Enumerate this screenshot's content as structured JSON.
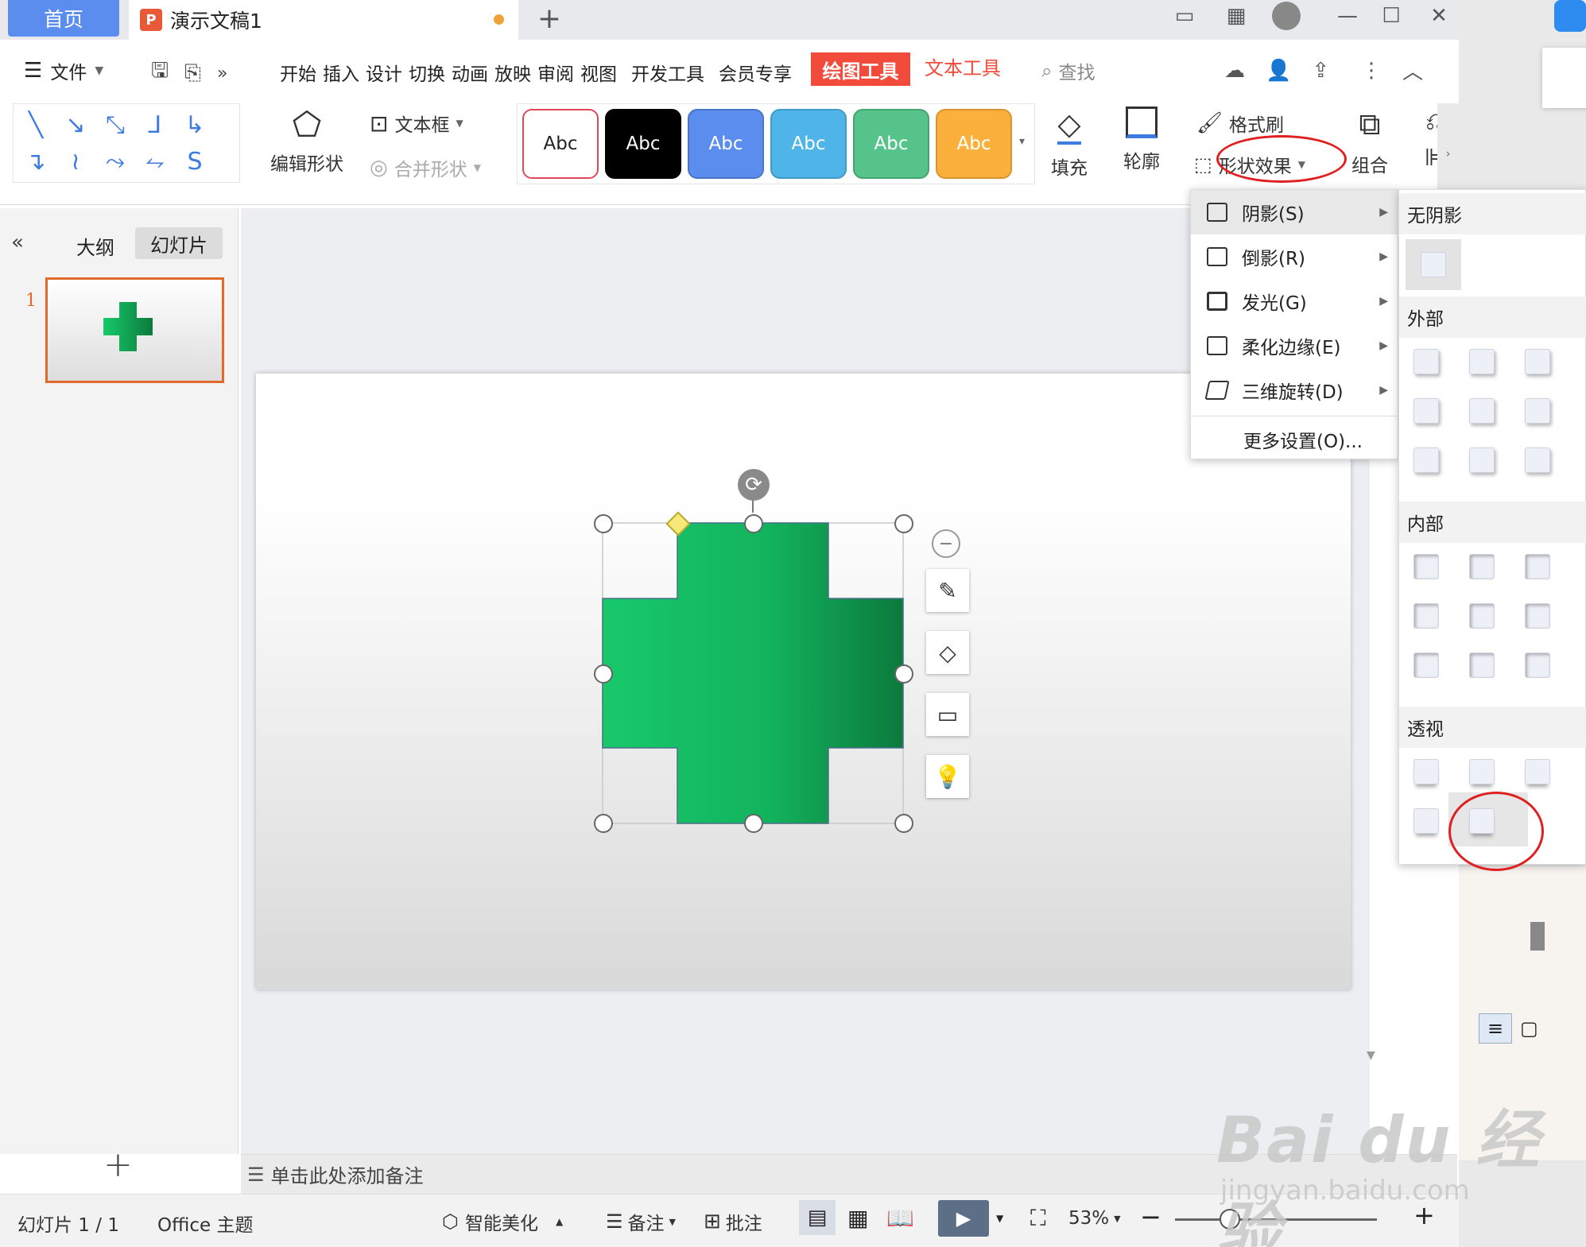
{
  "tabs": {
    "home": "首页",
    "document": "演示文稿1",
    "new_tab": "+"
  },
  "menu": {
    "file": "文件",
    "items": [
      "开始",
      "插入",
      "设计",
      "切换",
      "动画",
      "放映",
      "审阅",
      "视图",
      "开发工具",
      "会员专享"
    ],
    "drawing_tools": "绘图工具",
    "text_tools": "文本工具",
    "search": "查找"
  },
  "ribbon": {
    "edit_shape": "编辑形状",
    "text_box": "文本框",
    "merge_shapes": "合并形状",
    "style_samples": [
      {
        "label": "Abc",
        "bg": "#ffffff",
        "fg": "#222222",
        "border": "#e0485a"
      },
      {
        "label": "Abc",
        "bg": "#000000",
        "fg": "#ffffff",
        "border": "#000000"
      },
      {
        "label": "Abc",
        "bg": "#5b8def",
        "fg": "#ffffff",
        "border": "#4a74c9"
      },
      {
        "label": "Abc",
        "bg": "#4fb5e8",
        "fg": "#ffffff",
        "border": "#3f9ac8"
      },
      {
        "label": "Abc",
        "bg": "#56c48a",
        "fg": "#ffffff",
        "border": "#46a372"
      },
      {
        "label": "Abc",
        "bg": "#fbb03b",
        "fg": "#ffffff",
        "border": "#d9942d"
      }
    ],
    "fill": "填充",
    "outline": "轮廓",
    "format_painter": "格式刷",
    "shape_effects": "形状效果",
    "group": "组合"
  },
  "left_panel": {
    "outline_tab": "大纲",
    "slides_tab": "幻灯片",
    "slide_number": "1",
    "add": "+"
  },
  "effects_menu": {
    "items": [
      {
        "label": "阴影(S)"
      },
      {
        "label": "倒影(R)"
      },
      {
        "label": "发光(G)"
      },
      {
        "label": "柔化边缘(E)"
      },
      {
        "label": "三维旋转(D)"
      }
    ],
    "more": "更多设置(O)..."
  },
  "shadow_gallery": {
    "no_shadow": "无阴影",
    "outer": "外部",
    "inner": "内部",
    "perspective": "透视"
  },
  "notes": {
    "placeholder": "单击此处添加备注"
  },
  "status": {
    "slide_info": "幻灯片 1 / 1",
    "theme": "Office 主题",
    "beautify": "智能美化",
    "notes": "备注",
    "comment": "批注",
    "zoom": "53%"
  },
  "shape": {
    "gradient_start": "#17c96a",
    "gradient_end": "#0c7a3c"
  },
  "colors": {
    "accent": "#5b8def",
    "drawing_tools": "#f24b3b",
    "selection": "#e06a2b"
  },
  "watermark": {
    "brand": "Bai du 经验",
    "url": "jingyan.baidu.com"
  }
}
